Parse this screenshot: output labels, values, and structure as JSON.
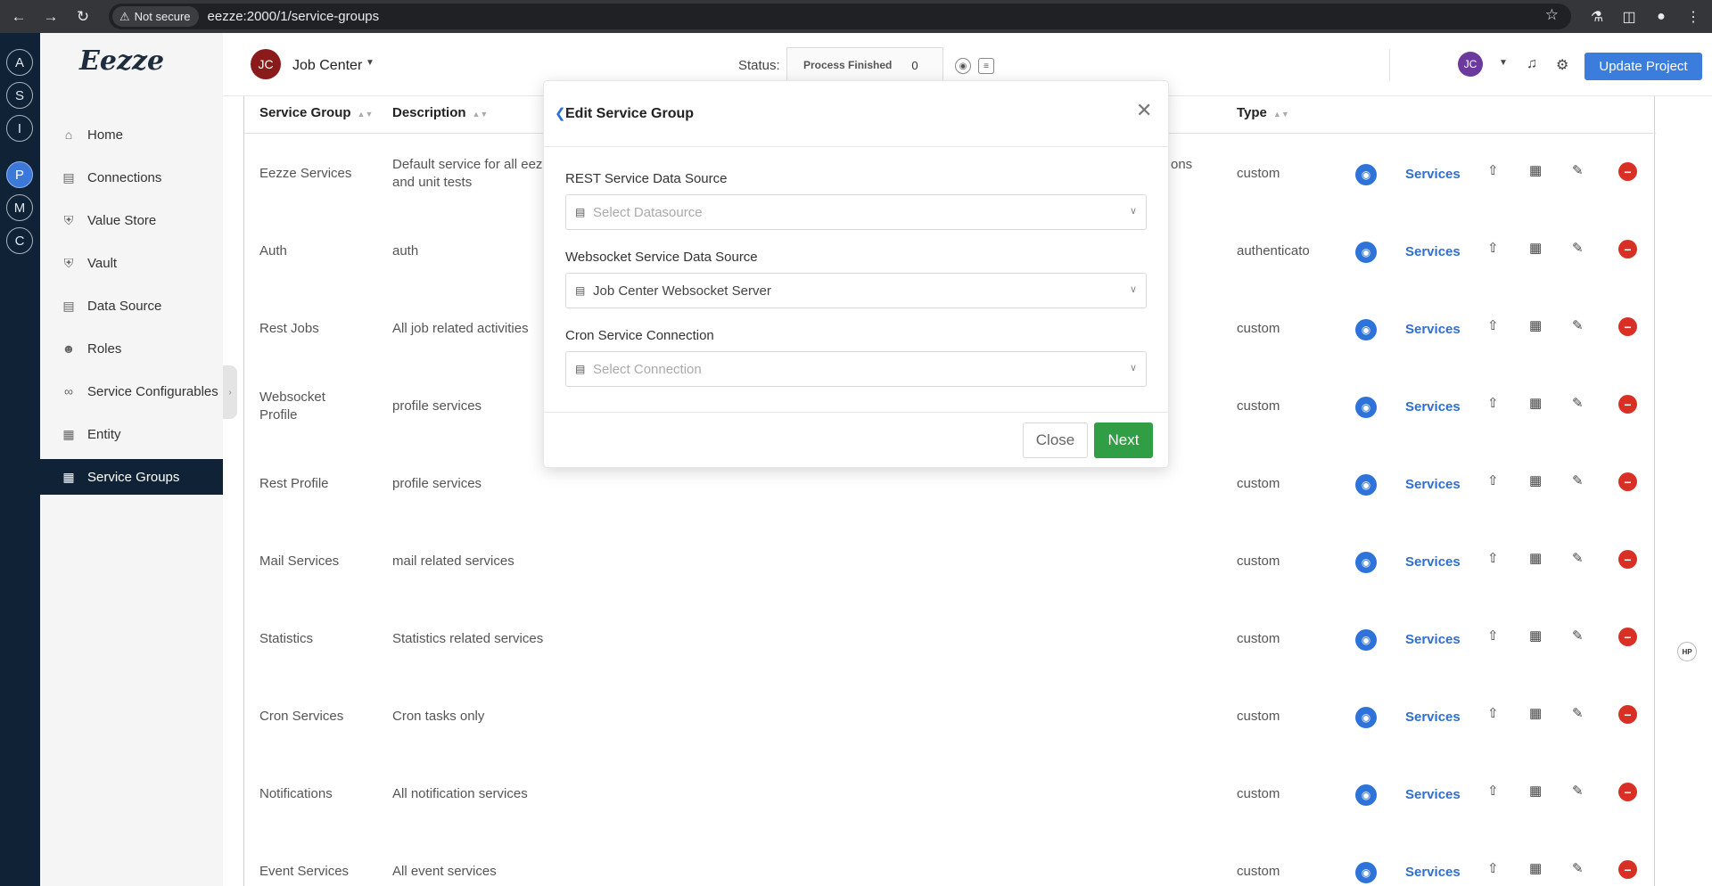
{
  "browser": {
    "security_label": "Not secure",
    "url": "eezze:2000/1/service-groups"
  },
  "rail": {
    "items": [
      "A",
      "S",
      "I",
      "P",
      "M",
      "C"
    ],
    "active": "P"
  },
  "sidebar": {
    "logo": "Eezze",
    "items": [
      {
        "label": "Home",
        "icon": "home-icon"
      },
      {
        "label": "Connections",
        "icon": "chart-icon"
      },
      {
        "label": "Value Store",
        "icon": "shield-icon"
      },
      {
        "label": "Vault",
        "icon": "shield-icon"
      },
      {
        "label": "Data Source",
        "icon": "database-icon"
      },
      {
        "label": "Roles",
        "icon": "users-icon"
      },
      {
        "label": "Service Configurables",
        "icon": "paperclip-icon"
      },
      {
        "label": "Entity",
        "icon": "table-icon"
      },
      {
        "label": "Service Groups",
        "icon": "grid-icon"
      }
    ],
    "active": "Service Groups"
  },
  "header": {
    "project_initials": "JC",
    "project_name": "Job Center",
    "status_label": "Status:",
    "status_text": "Process Finished",
    "status_count": "0",
    "user_initials": "JC",
    "update_button": "Update Project"
  },
  "table": {
    "columns": [
      "Service Group",
      "Description",
      "Type"
    ],
    "action_link": "Services",
    "rows": [
      {
        "group": "Eezze Services",
        "description": "Default service for all eezze\nand unit tests",
        "desc_tail": "ons",
        "type": "custom"
      },
      {
        "group": "Auth",
        "description": "auth",
        "desc_tail": "",
        "type": "authenticato"
      },
      {
        "group": "Rest Jobs",
        "description": "All job related activities",
        "desc_tail": "",
        "type": "custom"
      },
      {
        "group": "Websocket\nProfile",
        "description": "profile services",
        "desc_tail": "",
        "type": "custom"
      },
      {
        "group": "Rest Profile",
        "description": "profile services",
        "desc_tail": "",
        "type": "custom"
      },
      {
        "group": "Mail Services",
        "description": "mail related services",
        "desc_tail": "",
        "type": "custom"
      },
      {
        "group": "Statistics",
        "description": "Statistics related services",
        "desc_tail": "",
        "type": "custom"
      },
      {
        "group": "Cron Services",
        "description": "Cron tasks only",
        "desc_tail": "",
        "type": "custom"
      },
      {
        "group": "Notifications",
        "description": "All notification services",
        "desc_tail": "",
        "type": "custom"
      },
      {
        "group": "Event Services",
        "description": "All event services",
        "desc_tail": "",
        "type": "custom"
      }
    ]
  },
  "badge": "HP",
  "modal": {
    "title": "Edit Service Group",
    "fields": [
      {
        "label": "REST Service Data Source",
        "value": "",
        "placeholder": "Select Datasource"
      },
      {
        "label": "Websocket Service Data Source",
        "value": "Job Center Websocket Server",
        "placeholder": ""
      },
      {
        "label": "Cron Service Connection",
        "value": "",
        "placeholder": "Select Connection"
      }
    ],
    "close_button": "Close",
    "next_button": "Next"
  },
  "colors": {
    "rail_bg": "#0f2236",
    "accent_blue": "#3b7ddd",
    "next_green": "#2f9e44",
    "delete_red": "#d93025",
    "project_avatar": "#8b1a1a",
    "user_avatar": "#6c3a9e"
  }
}
